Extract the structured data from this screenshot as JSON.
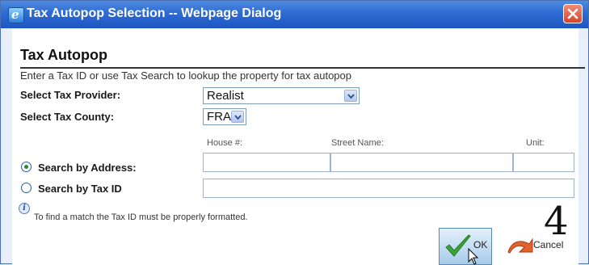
{
  "window": {
    "title": "Tax Autopop Selection -- Webpage Dialog",
    "title_icon": "ie-icon",
    "close_icon": "close-icon"
  },
  "dialog": {
    "heading": "Tax Autopop",
    "intro": "Enter a Tax ID or use Tax Search to lookup the property for tax autopop",
    "provider": {
      "label": "Select Tax Provider:",
      "value": "Realist"
    },
    "county": {
      "label": "Select Tax County:",
      "value": "FRA"
    },
    "columns": {
      "house": "House #:",
      "street": "Street Name:",
      "unit": "Unit:"
    },
    "address": {
      "label": "Search by Address:",
      "checked": true,
      "house": "",
      "street": "",
      "unit": ""
    },
    "taxid": {
      "label": "Search by Tax ID",
      "checked": false,
      "value": ""
    },
    "note": "To find a match the Tax ID must be properly formatted.",
    "ok": {
      "label": "OK",
      "icon": "checkmark-icon"
    },
    "cancel": {
      "label": "Cancel",
      "icon": "undo-arrow-icon"
    }
  },
  "step_number": "4",
  "colors": {
    "titlebar": "#2d6ad1",
    "accent_green": "#3aa43a",
    "cancel_orange": "#e0622e"
  }
}
